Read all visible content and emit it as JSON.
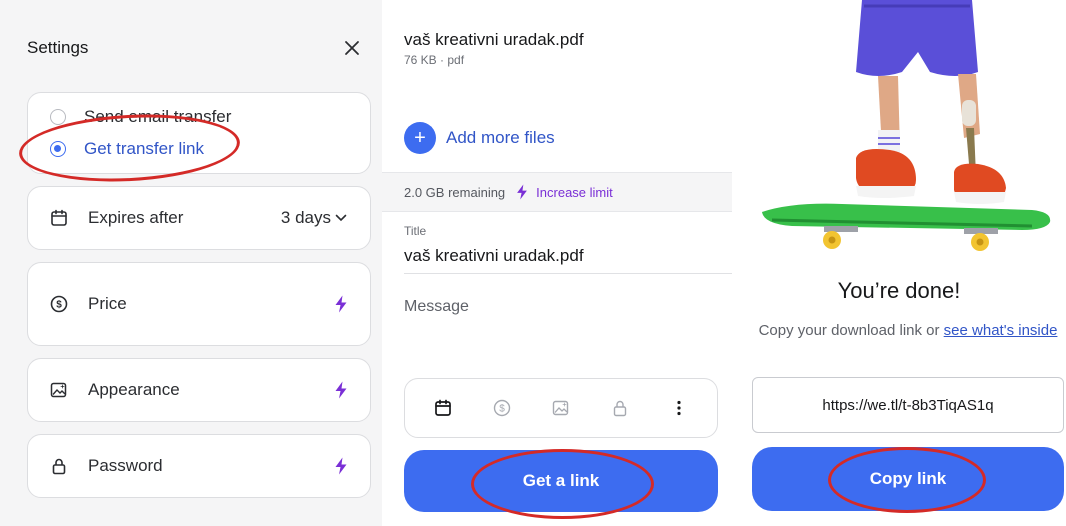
{
  "settings": {
    "title": "Settings",
    "transfer_options": [
      {
        "label": "Send email transfer",
        "selected": false
      },
      {
        "label": "Get transfer link",
        "selected": true
      }
    ],
    "expires": {
      "label": "Expires after",
      "value": "3 days"
    },
    "options": [
      {
        "label": "Price",
        "icon": "dollar-circle-icon"
      },
      {
        "label": "Appearance",
        "icon": "image-sparkle-icon"
      },
      {
        "label": "Password",
        "icon": "lock-icon"
      }
    ]
  },
  "transfer": {
    "file_name": "vaš kreativni uradak.pdf",
    "file_meta": "76 KB · pdf",
    "add_files_label": "Add more files",
    "remaining": "2.0 GB remaining",
    "increase_limit": "Increase limit",
    "title_label": "Title",
    "title_value": "vaš kreativni uradak.pdf",
    "message_placeholder": "Message",
    "get_link_label": "Get a link"
  },
  "done": {
    "title": "You’re done!",
    "subtitle_prefix": "Copy your download link or ",
    "subtitle_link": "see what's inside",
    "url": "https://we.tl/t-8b3TiqAS1q",
    "copy_label": "Copy link"
  },
  "colors": {
    "accent": "#3d6cf0",
    "link_text": "#3155c7",
    "premium": "#7a2fd6",
    "annotation": "#d42a27"
  }
}
